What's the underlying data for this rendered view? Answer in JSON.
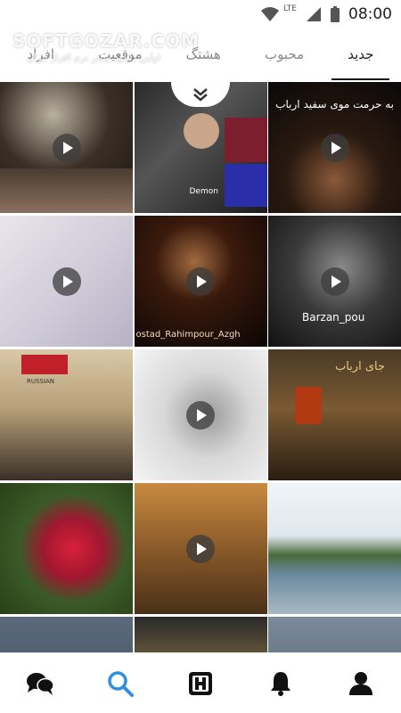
{
  "status_bar": {
    "time": "08:00",
    "network": "LTE",
    "icons": [
      "wifi-icon",
      "signal-icon",
      "battery-icon"
    ]
  },
  "watermark": {
    "text": "SOFTGOZAR.COM",
    "subtext": "اولین دانلود سنتر نرم افزار ایران"
  },
  "tabs": [
    {
      "label": "جدید",
      "active": true
    },
    {
      "label": "محبوب",
      "active": false
    },
    {
      "label": "هشتگ",
      "active": false
    },
    {
      "label": "موقعیت",
      "active": false
    },
    {
      "label": "افراد",
      "active": false
    }
  ],
  "grid": {
    "tiles": [
      {
        "type": "video",
        "caption": ""
      },
      {
        "type": "image",
        "caption": "",
        "overlay_text": "Demon"
      },
      {
        "type": "video",
        "caption": "به حرمت موی سفید ارباب"
      },
      {
        "type": "video",
        "caption": ""
      },
      {
        "type": "video",
        "caption": "ostad_Rahimpour_Azgh"
      },
      {
        "type": "video",
        "caption": "Barzan_pou"
      },
      {
        "type": "image",
        "caption": "",
        "overlay_text": "RUSSIAN"
      },
      {
        "type": "video",
        "caption": ""
      },
      {
        "type": "image",
        "caption": "جای ارباب"
      },
      {
        "type": "image",
        "caption": ""
      },
      {
        "type": "video",
        "caption": ""
      },
      {
        "type": "image",
        "caption": ""
      },
      {
        "type": "image",
        "caption": ""
      },
      {
        "type": "image",
        "caption": ""
      },
      {
        "type": "image",
        "caption": ""
      }
    ]
  },
  "bottom_nav": [
    {
      "name": "chat-icon",
      "active": false
    },
    {
      "name": "search-icon",
      "active": true
    },
    {
      "name": "app-logo-icon",
      "active": false
    },
    {
      "name": "bell-icon",
      "active": false
    },
    {
      "name": "profile-icon",
      "active": false
    }
  ],
  "colors": {
    "accent": "#2f8fe0",
    "text_dark": "#222222",
    "text_muted": "#888888"
  }
}
